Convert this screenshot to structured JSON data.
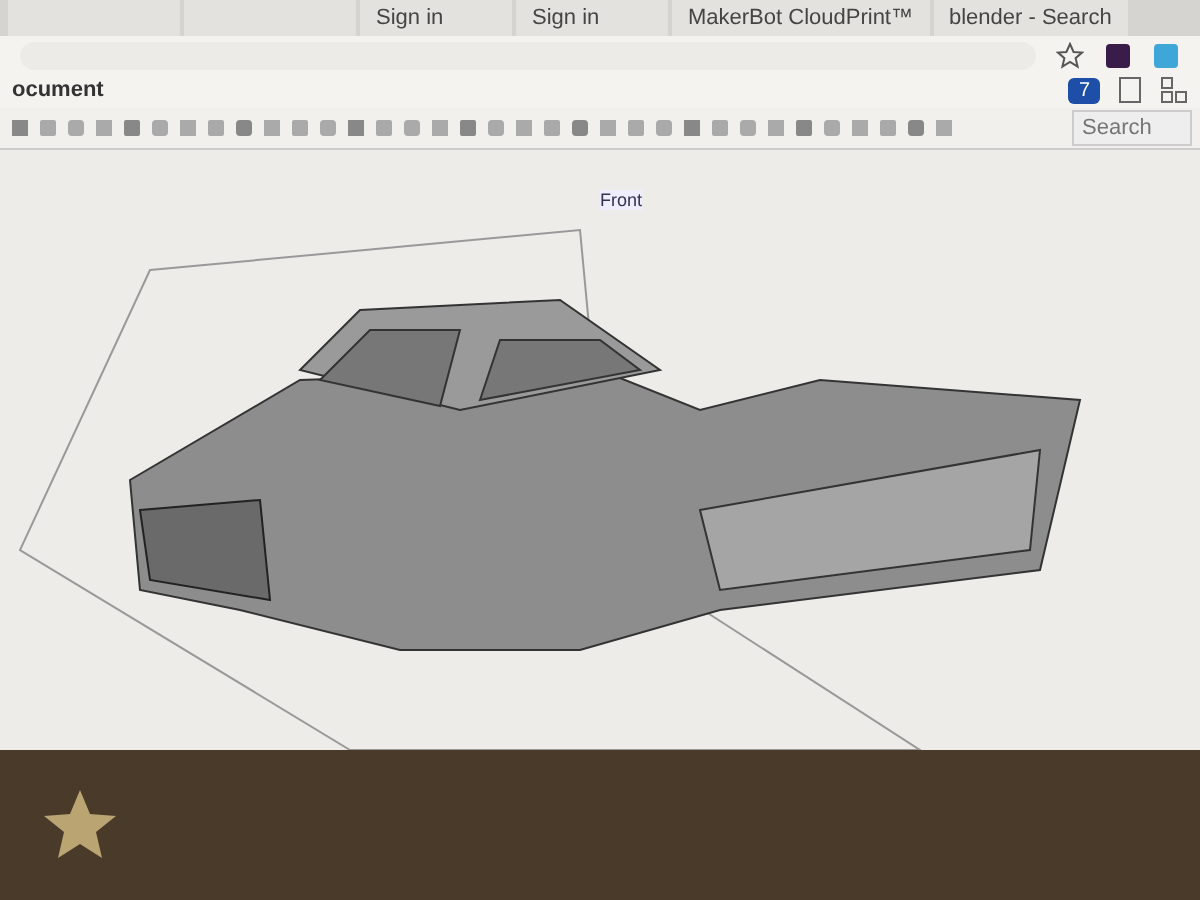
{
  "browser": {
    "tabs": [
      {
        "label": "Sign in",
        "selected": false
      },
      {
        "label": "Sign in",
        "selected": false
      },
      {
        "label": "MakerBot CloudPrint™",
        "selected": false
      },
      {
        "label": "blender - Search",
        "selected": false
      }
    ]
  },
  "document": {
    "title": "ocument"
  },
  "notifications": {
    "count": "7"
  },
  "search": {
    "placeholder": "Search"
  },
  "viewport": {
    "plane_label": "Front"
  }
}
